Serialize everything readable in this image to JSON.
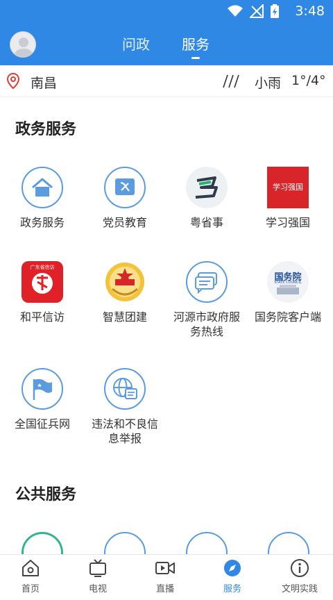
{
  "status_bar": {
    "time": "3:48"
  },
  "header": {
    "tabs": [
      "问政",
      "服务"
    ],
    "active_tab": 1
  },
  "weather": {
    "city": "南昌",
    "condition": "小雨",
    "temperature": "1°/4°"
  },
  "sections": {
    "gov": {
      "title": "政务服务",
      "items": [
        {
          "label": "政务服务",
          "icon": "home-icon"
        },
        {
          "label": "党员教育",
          "icon": "party-flag-icon"
        },
        {
          "label": "粤省事",
          "icon": "yueshengshi-logo"
        },
        {
          "label": "学习强国",
          "icon": "xuexi-qiangguo-logo"
        },
        {
          "label": "和平信访",
          "icon": "heping-xinfang-logo"
        },
        {
          "label": "智慧团建",
          "icon": "youth-league-emblem-icon"
        },
        {
          "label": "河源市政府服务热线",
          "icon": "chat-bubbles-icon"
        },
        {
          "label": "国务院客户端",
          "icon": "state-council-logo"
        },
        {
          "label": "全国征兵网",
          "icon": "flag-icon"
        },
        {
          "label": "违法和不良信息举报",
          "icon": "globe-report-icon"
        }
      ]
    },
    "public": {
      "title": "公共服务"
    }
  },
  "logos": {
    "xuexi_text": "学习强国",
    "guowuyuan_text": "国务院",
    "guowuyuan_sub": "STATE COUNCIL",
    "heping_sub": "广东省信访"
  },
  "bottom_nav": {
    "items": [
      "首页",
      "电视",
      "直播",
      "服务",
      "文明实践"
    ],
    "active": 3
  },
  "colors": {
    "primary": "#2e88e4",
    "icon_blue": "#5b9be0",
    "red": "#d7252a"
  }
}
